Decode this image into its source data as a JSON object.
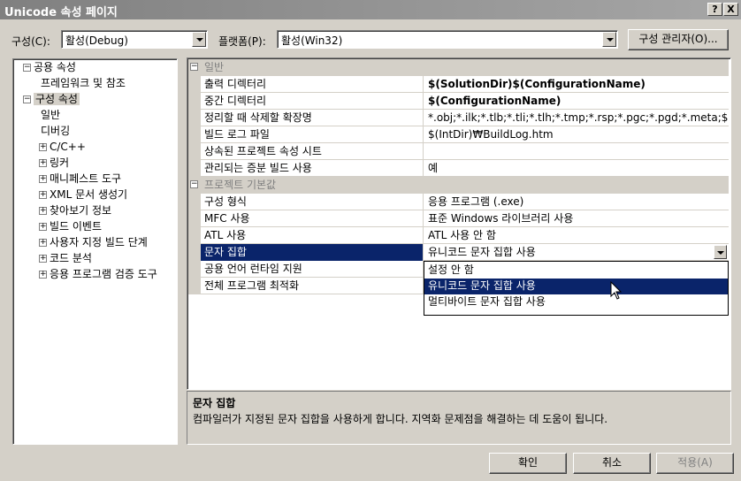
{
  "window": {
    "title": "Unicode 속성 페이지",
    "help_btn": "?",
    "close_btn": "X"
  },
  "toolbar": {
    "config_label": "구성(C):",
    "config_value": "활성(Debug)",
    "platform_label": "플랫폼(P):",
    "platform_value": "활성(Win32)",
    "config_manager": "구성 관리자(O)..."
  },
  "tree": {
    "items": [
      {
        "label": "공용 속성",
        "box": "−"
      },
      {
        "label": "프레임워크 및 참조"
      },
      {
        "label": "구성 속성",
        "box": "−"
      },
      {
        "label": "일반"
      },
      {
        "label": "디버깅"
      },
      {
        "label": "C/C++",
        "box": "+"
      },
      {
        "label": "링커",
        "box": "+"
      },
      {
        "label": "매니페스트 도구",
        "box": "+"
      },
      {
        "label": "XML 문서 생성기",
        "box": "+"
      },
      {
        "label": "찾아보기 정보",
        "box": "+"
      },
      {
        "label": "빌드 이벤트",
        "box": "+"
      },
      {
        "label": "사용자 지정 빌드 단계",
        "box": "+"
      },
      {
        "label": "코드 분석",
        "box": "+"
      },
      {
        "label": "응용 프로그램 검증 도구",
        "box": "+"
      }
    ]
  },
  "grid": {
    "cat1": {
      "label": "일반",
      "box": "−"
    },
    "rows1": [
      {
        "name": "출력 디렉터리",
        "value": "$(SolutionDir)$(ConfigurationName)"
      },
      {
        "name": "중간 디렉터리",
        "value": "$(ConfigurationName)"
      },
      {
        "name": "정리할 때 삭제할 확장명",
        "value": "*.obj;*.ilk;*.tlb;*.tli;*.tlh;*.tmp;*.rsp;*.pgc;*.pgd;*.meta;$(TargetPa"
      },
      {
        "name": "빌드 로그 파일",
        "value": "$(IntDir)₩BuildLog.htm"
      },
      {
        "name": "상속된 프로젝트 속성 시트",
        "value": ""
      },
      {
        "name": "관리되는 증분 빌드 사용",
        "value": "예"
      }
    ],
    "cat2": {
      "label": "프로젝트 기본값",
      "box": "−"
    },
    "rows2": [
      {
        "name": "구성 형식",
        "value": "응용 프로그램 (.exe)"
      },
      {
        "name": "MFC 사용",
        "value": "표준 Windows 라이브러리 사용"
      },
      {
        "name": "ATL 사용",
        "value": "ATL 사용 안 함"
      },
      {
        "name": "문자 집합",
        "value": "유니코드 문자 집합 사용"
      },
      {
        "name": "공용 언어 런타임 지원",
        "value": ""
      },
      {
        "name": "전체 프로그램 최적화",
        "value": ""
      }
    ]
  },
  "dropdown": {
    "options": [
      "설정 안 함",
      "유니코드 문자 집합 사용",
      "멀티바이트 문자 집합 사용"
    ],
    "highlighted_index": 1
  },
  "description": {
    "title": "문자 집합",
    "text": "컴파일러가 지정된 문자 집합을 사용하게 합니다. 지역화 문제점을 해결하는 데 도움이 됩니다."
  },
  "buttons": {
    "ok": "확인",
    "cancel": "취소",
    "apply": "적용(A)"
  },
  "colors": {
    "selection": "#0a246a",
    "face": "#d4d0c8"
  }
}
